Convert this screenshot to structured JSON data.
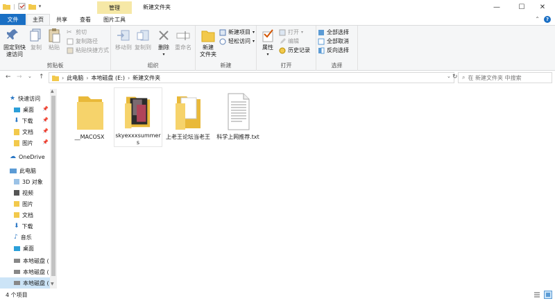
{
  "titlebar": {
    "title": "新建文件夹",
    "contextual_tab": "管理",
    "controls": {
      "minimize": "—",
      "maximize": "☐",
      "close": "✕"
    }
  },
  "tabs": {
    "file": "文件",
    "home": "主页",
    "share": "共享",
    "view": "查看",
    "picture_tools": "图片工具"
  },
  "ribbon": {
    "clipboard": {
      "label": "剪贴板",
      "pin": "固定到快\n速访问",
      "copy": "复制",
      "paste": "粘贴",
      "cut": "剪切",
      "copy_path": "复制路径",
      "paste_shortcut": "粘贴快捷方式"
    },
    "organize": {
      "label": "组织",
      "move_to": "移动到",
      "copy_to": "复制到",
      "delete": "删除",
      "rename": "重命名"
    },
    "new": {
      "label": "新建",
      "new_folder": "新建\n文件夹",
      "new_item": "新建项目",
      "easy_access": "轻松访问"
    },
    "open": {
      "label": "打开",
      "properties": "属性",
      "open": "打开",
      "edit": "编辑",
      "history": "历史记录"
    },
    "select": {
      "label": "选择",
      "select_all": "全部选择",
      "select_none": "全部取消",
      "invert": "反向选择"
    }
  },
  "address": {
    "crumbs": [
      "此电脑",
      "本地磁盘 (E:)",
      "新建文件夹"
    ],
    "search_placeholder": "在 新建文件夹 中搜索"
  },
  "nav": {
    "quick_access": "快速访问",
    "quick_items": [
      "桌面",
      "下载",
      "文档",
      "图片"
    ],
    "onedrive": "OneDrive",
    "this_pc": "此电脑",
    "pc_items": [
      "3D 对象",
      "视频",
      "图片",
      "文档",
      "下载",
      "音乐",
      "桌面"
    ],
    "drives": [
      "本地磁盘 (",
      "本地磁盘 (",
      "本地磁盘 ("
    ]
  },
  "files": [
    {
      "name": "__MACOSX",
      "type": "folder"
    },
    {
      "name": "skyexxxsummers",
      "type": "folder-image"
    },
    {
      "name": "上老王论坛当老王",
      "type": "folder-doc"
    },
    {
      "name": "科学上网推荐.txt",
      "type": "txt"
    }
  ],
  "status": {
    "item_count": "4 个项目"
  },
  "colors": {
    "accent": "#1a6fc4",
    "folder": "#f2c94c",
    "selected": "#cce4f7",
    "context_tab": "#f6e8a6"
  }
}
